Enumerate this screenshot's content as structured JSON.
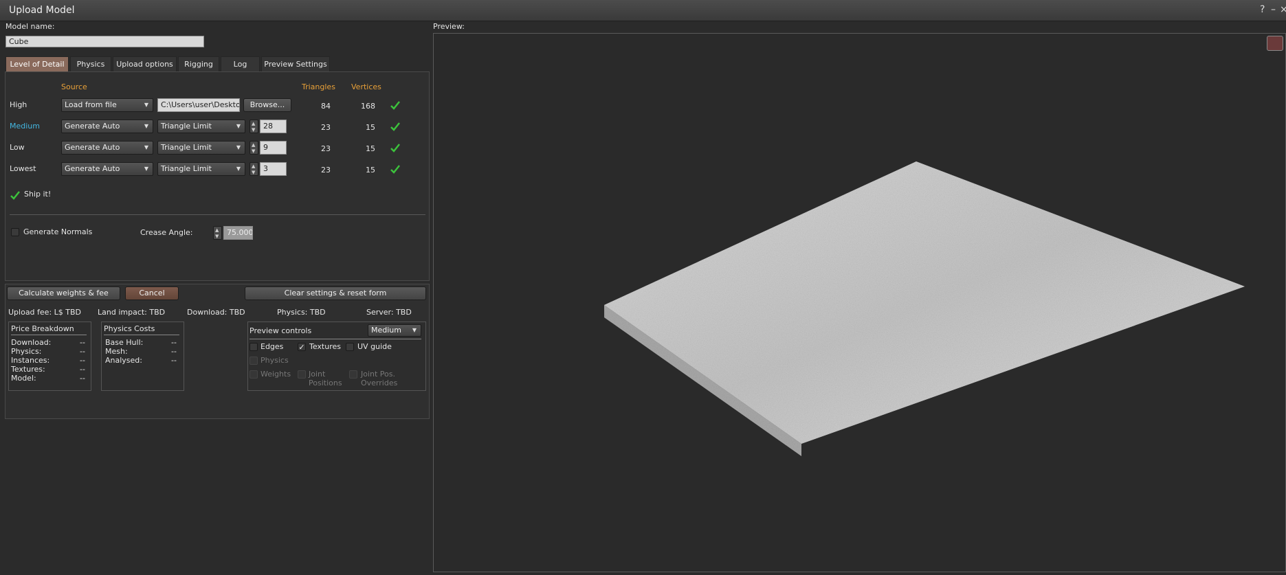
{
  "window": {
    "title": "Upload Model",
    "help": "?",
    "minimize": "–",
    "close": "×"
  },
  "model_name": {
    "label": "Model name:",
    "value": "Cube"
  },
  "tabs": [
    {
      "label": "Level of Detail"
    },
    {
      "label": "Physics"
    },
    {
      "label": "Upload options"
    },
    {
      "label": "Rigging"
    },
    {
      "label": "Log"
    },
    {
      "label": "Preview Settings"
    }
  ],
  "lod": {
    "headers": {
      "source": "Source",
      "triangles": "Triangles",
      "vertices": "Vertices"
    },
    "rows": [
      {
        "name": "High",
        "source": "Load from file",
        "file": "C:\\Users\\user\\Desktop",
        "browse": "Browse...",
        "triangles": "84",
        "vertices": "168"
      },
      {
        "name": "Medium",
        "source": "Generate Auto",
        "method": "Triangle Limit",
        "limit": "28",
        "triangles": "23",
        "vertices": "15"
      },
      {
        "name": "Low",
        "source": "Generate Auto",
        "method": "Triangle Limit",
        "limit": "9",
        "triangles": "23",
        "vertices": "15"
      },
      {
        "name": "Lowest",
        "source": "Generate Auto",
        "method": "Triangle Limit",
        "limit": "3",
        "triangles": "23",
        "vertices": "15"
      }
    ],
    "ship_it": "Ship it!",
    "generate_normals": "Generate Normals",
    "crease_angle_label": "Crease Angle:",
    "crease_angle_value": "75.000"
  },
  "actions": {
    "calculate": "Calculate weights & fee",
    "cancel": "Cancel",
    "clear": "Clear settings & reset form"
  },
  "fees": {
    "upload_fee": "Upload fee: L$ TBD",
    "land_impact": "Land impact: TBD",
    "download": "Download: TBD",
    "physics": "Physics: TBD",
    "server": "Server: TBD"
  },
  "price_breakdown": {
    "title": "Price Breakdown",
    "rows": [
      {
        "label": "Download:",
        "value": "--"
      },
      {
        "label": "Physics:",
        "value": "--"
      },
      {
        "label": "Instances:",
        "value": "--"
      },
      {
        "label": "Textures:",
        "value": "--"
      },
      {
        "label": "Model:",
        "value": "--"
      }
    ]
  },
  "physics_costs": {
    "title": "Physics Costs",
    "rows": [
      {
        "label": "Base Hull:",
        "value": "--"
      },
      {
        "label": "Mesh:",
        "value": "--"
      },
      {
        "label": "Analysed:",
        "value": "--"
      }
    ]
  },
  "preview_controls": {
    "title": "Preview controls",
    "lod_select": "Medium",
    "edges": "Edges",
    "textures": "Textures",
    "uv_guide": "UV guide",
    "physics": "Physics",
    "weights": "Weights",
    "joint_positions_1": "Joint",
    "joint_positions_2": "Positions",
    "joint_overrides_1": "Joint Pos.",
    "joint_overrides_2": "Overrides"
  },
  "preview": {
    "label": "Preview:"
  },
  "colors": {
    "accent_orange": "#e8a038",
    "accent_blue": "#43b6e0",
    "check_green": "#3cc23c"
  }
}
